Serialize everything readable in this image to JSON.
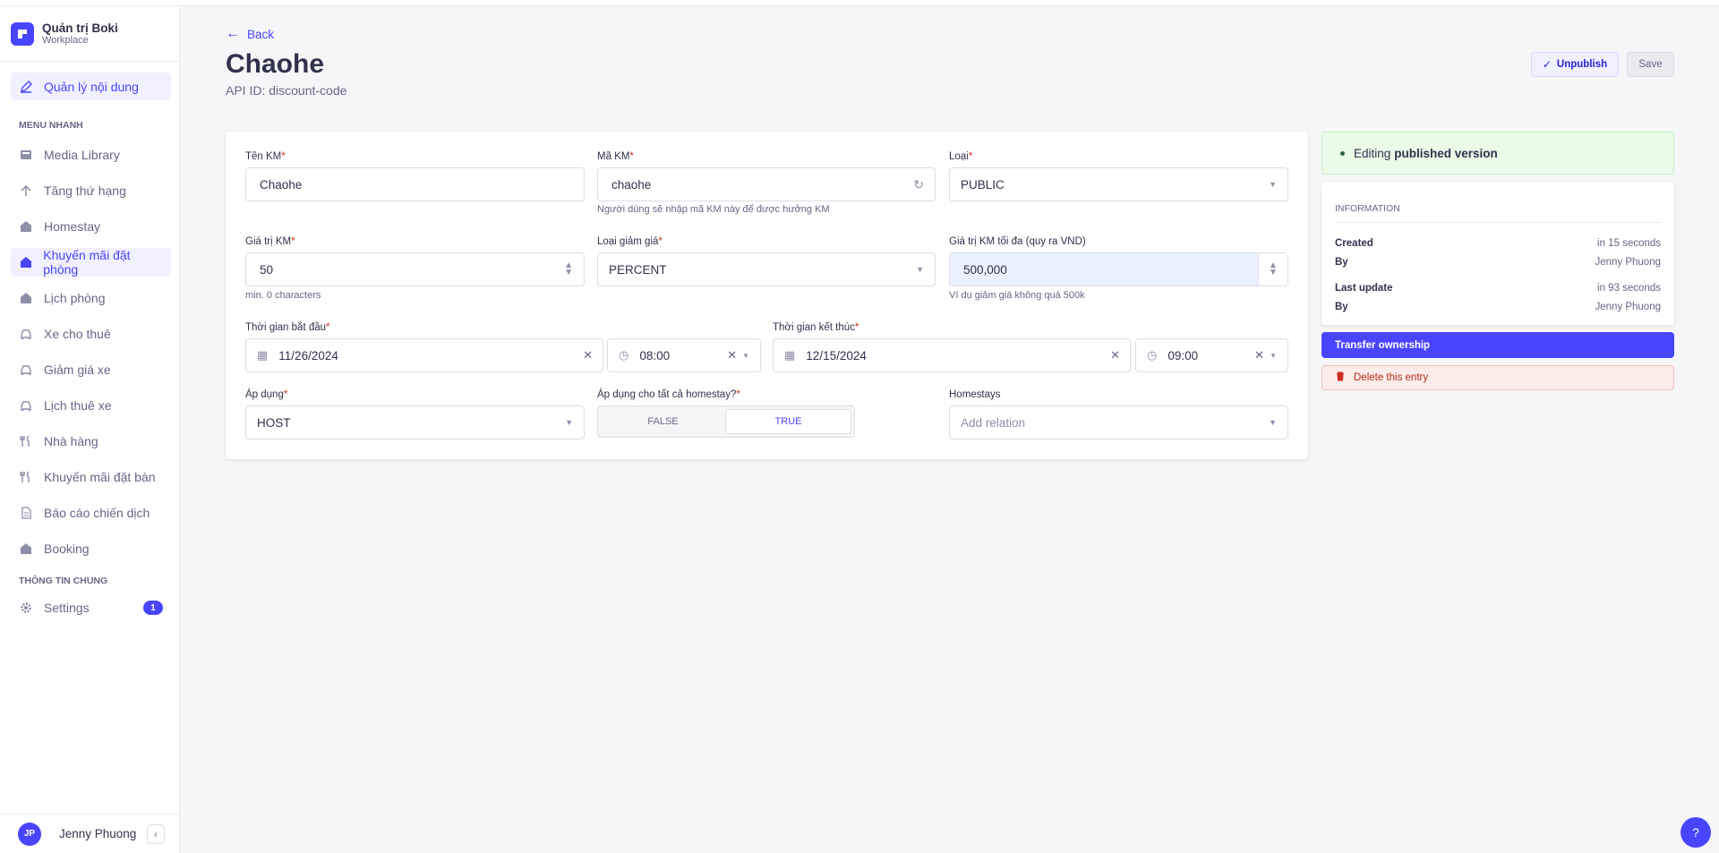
{
  "brand": {
    "title": "Quản trị Boki",
    "subtitle": "Workplace",
    "logo": "boki-logo"
  },
  "sidebar": {
    "main_item": "Quản lý nội dung",
    "section1": "MENU NHANH",
    "items": [
      {
        "label": "Media Library",
        "icon": "image-icon",
        "active": false
      },
      {
        "label": "Tăng thứ hạng",
        "icon": "arrow-up-icon",
        "active": false
      },
      {
        "label": "Homestay",
        "icon": "house-icon",
        "active": false
      },
      {
        "label": "Khuyến mãi đặt phòng",
        "icon": "house-icon",
        "active": true
      },
      {
        "label": "Lịch phòng",
        "icon": "house-icon",
        "active": false
      },
      {
        "label": "Xe cho thuê",
        "icon": "car-icon",
        "active": false
      },
      {
        "label": "Giảm giá xe",
        "icon": "car-icon",
        "active": false
      },
      {
        "label": "Lịch thuê xe",
        "icon": "car-icon",
        "active": false
      },
      {
        "label": "Nhà hàng",
        "icon": "utensils-icon",
        "active": false
      },
      {
        "label": "Khuyến mãi đặt bàn",
        "icon": "utensils-icon",
        "active": false
      },
      {
        "label": "Báo cáo chiến dịch",
        "icon": "document-icon",
        "active": false
      },
      {
        "label": "Booking",
        "icon": "house-icon",
        "active": false
      }
    ],
    "section2": "THÔNG TIN CHUNG",
    "settings_label": "Settings",
    "settings_badge": "1",
    "user_initials": "JP",
    "user_name": "Jenny Phuong"
  },
  "header": {
    "back_label": "Back",
    "title": "Chaohe",
    "api_id": "API ID: discount-code",
    "unpublish_label": "Unpublish",
    "save_label": "Save"
  },
  "form": {
    "ten_km": {
      "label": "Tên KM",
      "value": "Chaohe"
    },
    "ma_km": {
      "label": "Mã KM",
      "value": "chaohe",
      "hint": "Người dùng sẽ nhập mã KM này để được hưởng KM"
    },
    "loai": {
      "label": "Loại",
      "value": "PUBLIC"
    },
    "gia_tri_km": {
      "label": "Giá trị KM",
      "value": "50",
      "hint": "min. 0 characters"
    },
    "loai_giam_gia": {
      "label": "Loại giảm giá",
      "value": "PERCENT"
    },
    "gia_tri_toi_da": {
      "label": "Giá trị KM tối đa (quy ra VND)",
      "value": "500,000",
      "hint": "Ví dụ giảm giá không quá 500k"
    },
    "thoi_gian_bat_dau": {
      "label": "Thời gian bắt đầu",
      "date": "11/26/2024",
      "time": "08:00"
    },
    "thoi_gian_ket_thuc": {
      "label": "Thời gian kết thúc",
      "date": "12/15/2024",
      "time": "09:00"
    },
    "ap_dung": {
      "label": "Áp dụng",
      "value": "HOST"
    },
    "ap_dung_tat_ca": {
      "label": "Áp dụng cho tất cả homestay?",
      "false_label": "FALSE",
      "true_label": "TRUE",
      "selected": "TRUE"
    },
    "homestays": {
      "label": "Homestays",
      "placeholder": "Add relation"
    }
  },
  "panel": {
    "status_prefix": "Editing",
    "status_bold": "published version",
    "info_title": "INFORMATION",
    "created_label": "Created",
    "created_value": "in 15 seconds",
    "created_by_label": "By",
    "created_by_value": "Jenny Phuong",
    "updated_label": "Last update",
    "updated_value": "in 93 seconds",
    "updated_by_label": "By",
    "updated_by_value": "Jenny Phuong",
    "transfer_label": "Transfer ownership",
    "delete_label": "Delete this entry"
  },
  "help_label": "?",
  "colors": {
    "accent": "#4945ff",
    "danger": "#d02b20",
    "success_bg": "#eafbe7"
  }
}
